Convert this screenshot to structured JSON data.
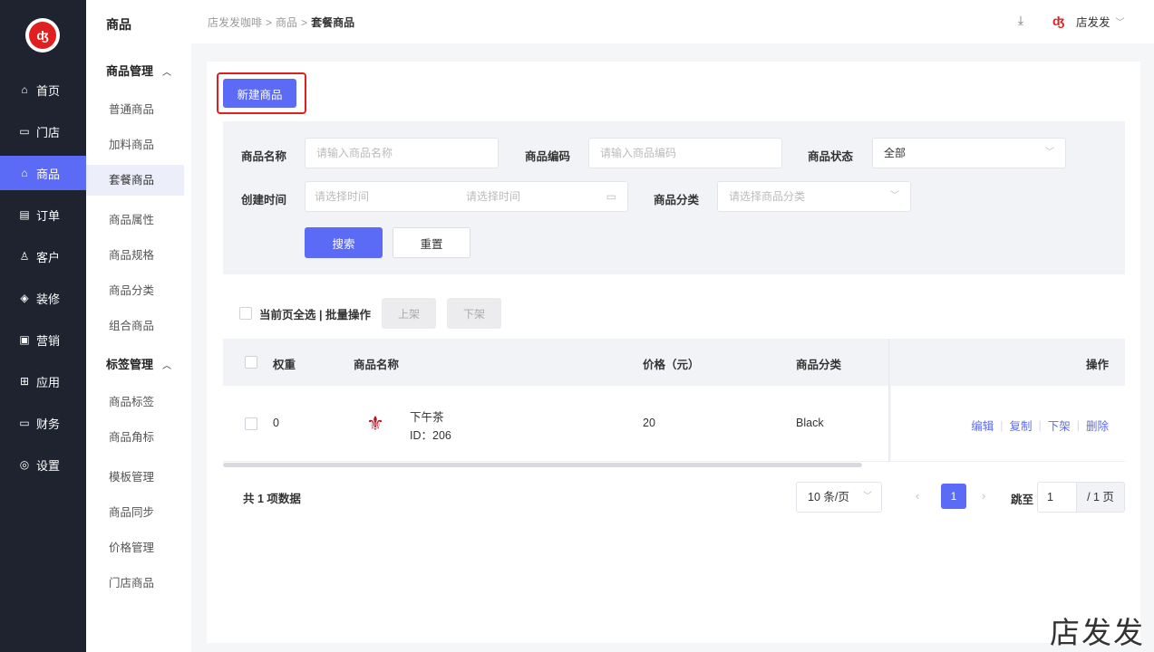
{
  "nav": {
    "logo_text": "ʤ",
    "items": [
      {
        "label": "首页",
        "icon": "home-icon",
        "glyph": "⌂"
      },
      {
        "label": "门店",
        "icon": "store-icon",
        "glyph": "▭"
      },
      {
        "label": "商品",
        "icon": "bag-icon",
        "glyph": "⌂"
      },
      {
        "label": "订单",
        "icon": "order-icon",
        "glyph": "▤"
      },
      {
        "label": "客户",
        "icon": "user-icon",
        "glyph": "♙"
      },
      {
        "label": "装修",
        "icon": "layers-icon",
        "glyph": "◈"
      },
      {
        "label": "营销",
        "icon": "gift-icon",
        "glyph": "▣"
      },
      {
        "label": "应用",
        "icon": "apps-icon",
        "glyph": "⊞"
      },
      {
        "label": "财务",
        "icon": "card-icon",
        "glyph": "▭"
      },
      {
        "label": "设置",
        "icon": "settings-icon",
        "glyph": "◎"
      }
    ],
    "active_index": 2
  },
  "submenu": {
    "title": "商品",
    "group1": "商品管理",
    "group1_items": [
      "普通商品",
      "加料商品",
      "套餐商品",
      "商品属性",
      "商品规格",
      "商品分类",
      "组合商品"
    ],
    "group2": "标签管理",
    "group2_items": [
      "商品标签",
      "商品角标"
    ],
    "extra_items": [
      "模板管理",
      "商品同步",
      "价格管理",
      "门店商品"
    ],
    "active": "套餐商品"
  },
  "header": {
    "breadcrumb": [
      "店发发咖啡",
      "商品",
      "套餐商品"
    ],
    "separator": ">",
    "user_name": "店发发",
    "logo_text": "ʤ"
  },
  "toolbar": {
    "new_button": "新建商品"
  },
  "filter": {
    "name_label": "商品名称",
    "name_placeholder": "请输入商品名称",
    "code_label": "商品编码",
    "code_placeholder": "请输入商品编码",
    "status_label": "商品状态",
    "status_value": "全部",
    "time_label": "创建时间",
    "time_start_placeholder": "请选择时间",
    "time_end_placeholder": "请选择时间",
    "category_label": "商品分类",
    "category_placeholder": "请选择商品分类",
    "search_button": "搜索",
    "reset_button": "重置"
  },
  "batch": {
    "label": "当前页全选 | 批量操作",
    "on_shelf": "上架",
    "off_shelf": "下架"
  },
  "table": {
    "columns": [
      "权重",
      "商品名称",
      "价格（元）",
      "商品分类",
      "操作"
    ],
    "rows": [
      {
        "weight": "0",
        "name": "下午茶",
        "id": "ID：206",
        "price": "20",
        "category": "Black",
        "actions": [
          "编辑",
          "复制",
          "下架",
          "删除"
        ]
      }
    ]
  },
  "pagination": {
    "total": "共 1 项数据",
    "page_size": "10 条/页",
    "current_page": "1",
    "goto_label": "跳至",
    "goto_value": "1",
    "total_pages": "/ 1 页"
  },
  "watermark": "店发发",
  "colors": {
    "accent": "#5b6bf5",
    "nav_bg": "#1f2330",
    "highlight": "#e02020"
  }
}
